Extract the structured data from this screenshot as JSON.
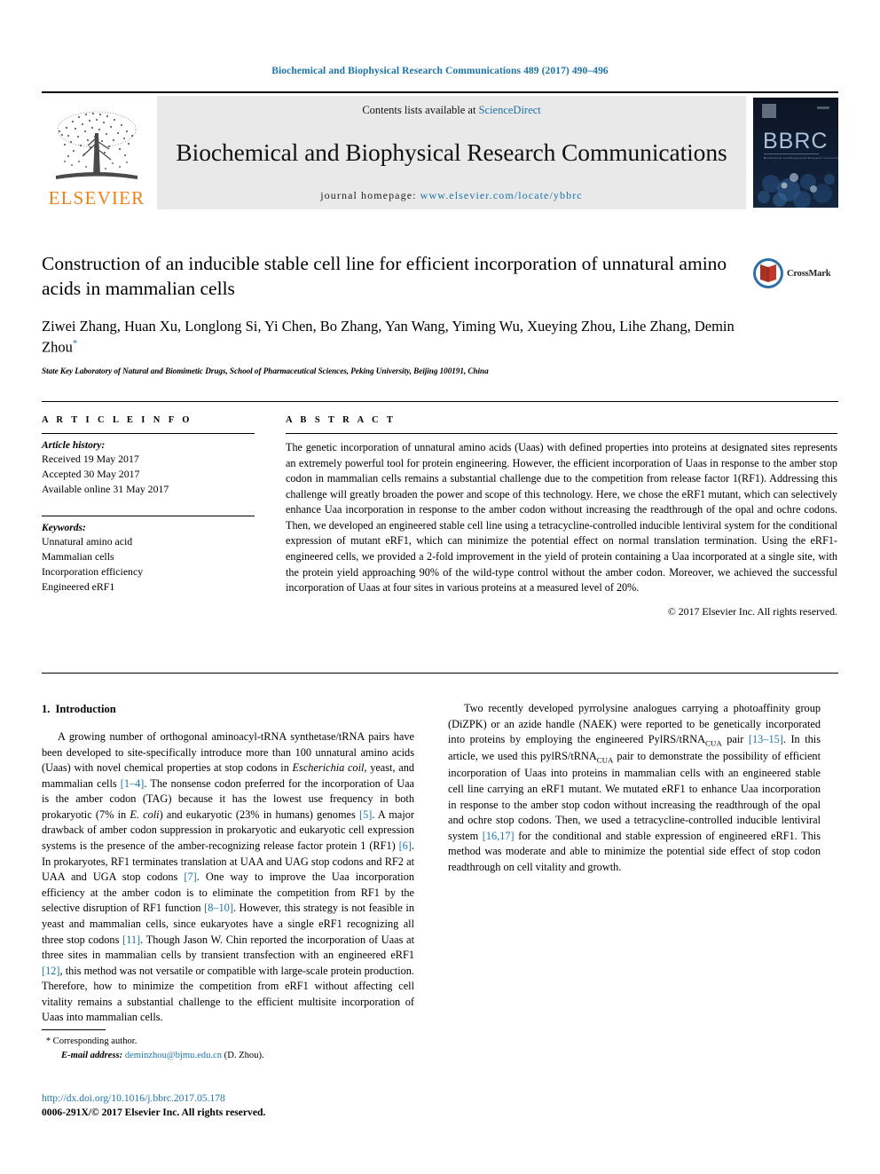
{
  "running_head": "Biochemical and Biophysical Research Communications 489 (2017) 490–496",
  "masthead": {
    "publisher_name": "ELSEVIER",
    "contents_prefix": "Contents lists available at ",
    "sciencedirect": "ScienceDirect",
    "journal_title": "Biochemical and Biophysical Research Communications",
    "homepage_label": "journal homepage: ",
    "homepage_url": "www.elsevier.com/locate/ybbrc",
    "cover_title": "BBRC",
    "cover_subtitle": "Biochemical and Biophysical Research Communications"
  },
  "crossmark": {
    "label": "CrossMark"
  },
  "article": {
    "title": "Construction of an inducible stable cell line for efficient incorporation of unnatural amino acids in mammalian cells",
    "authors": "Ziwei Zhang, Huan Xu, Longlong Si, Yi Chen, Bo Zhang, Yan Wang, Yiming Wu, Xueying Zhou, Lihe Zhang, Demin Zhou",
    "corresponding_marker": "*",
    "affiliation": "State Key Laboratory of Natural and Biomimetic Drugs, School of Pharmaceutical Sciences, Peking University, Beijing 100191, China"
  },
  "article_info": {
    "heading": "A R T I C L E   I N F O",
    "history_label": "Article history:",
    "history": [
      "Received 19 May 2017",
      "Accepted 30 May 2017",
      "Available online 31 May 2017"
    ],
    "keywords_label": "Keywords:",
    "keywords": [
      "Unnatural amino acid",
      "Mammalian cells",
      "Incorporation efficiency",
      "Engineered eRF1"
    ]
  },
  "abstract": {
    "heading": "A B S T R A C T",
    "text": "The genetic incorporation of unnatural amino acids (Uaas) with defined properties into proteins at designated sites represents an extremely powerful tool for protein engineering. However, the efficient incorporation of Uaas in response to the amber stop codon in mammalian cells remains a substantial challenge due to the competition from release factor 1(RF1). Addressing this challenge will greatly broaden the power and scope of this technology. Here, we chose the eRF1 mutant, which can selectively enhance Uaa incorporation in response to the amber codon without increasing the readthrough of the opal and ochre codons. Then, we developed an engineered stable cell line using a tetracycline-controlled inducible lentiviral system for the conditional expression of mutant eRF1, which can minimize the potential effect on normal translation termination. Using the eRF1-engineered cells, we provided a 2-fold improvement in the yield of protein containing a Uaa incorporated at a single site, with the protein yield approaching 90% of the wild-type control without the amber codon. Moreover, we achieved the successful incorporation of Uaas at four sites in various proteins at a measured level of 20%.",
    "copyright": "© 2017 Elsevier Inc. All rights reserved."
  },
  "introduction": {
    "number": "1.",
    "heading": "Introduction",
    "left_paragraph_1_parts": {
      "p1a": "A growing number of orthogonal aminoacyl-tRNA synthetase/tRNA pairs have been developed to site-specifically introduce more than 100 unnatural amino acids (Uaas) with novel chemical properties at stop codons in ",
      "p1_italic_1": "Escherichia coil",
      "p1b": ", yeast, and mammalian cells ",
      "ref1": "[1–4]",
      "p1c": ". The nonsense codon preferred for the incorporation of Uaa is the amber codon (TAG) because it has the lowest use frequency in both prokaryotic (7% in ",
      "p1_italic_2": "E. coli",
      "p1d": ") and eukaryotic (23% in humans) genomes ",
      "ref2": "[5]",
      "p1e": ". A major drawback of amber codon suppression in prokaryotic and eukaryotic cell expression systems is the presence of the amber-recognizing release factor protein 1 (RF1) ",
      "ref3": "[6]",
      "p1f": ". In prokaryotes, RF1 terminates translation at UAA and UAG stop codons and RF2 at UAA and UGA stop codons ",
      "ref4": "[7]",
      "p1g": ". One way to improve the Uaa incorporation efficiency at the amber codon is to eliminate the competition from RF1 by the selective disruption of RF1 function ",
      "ref5": "[8–10]",
      "p1h": ". However, this strategy is not feasible in yeast and mammalian cells, since eukaryotes have a single eRF1 recognizing all three stop codons ",
      "ref6": "[11]",
      "p1i": ". Though Jason W. Chin reported the incorporation of Uaas at three sites in mammalian cells by transient transfection with an engineered eRF1 ",
      "ref7": "[12]",
      "p1j": ", this method was not versatile or compatible with large-scale protein production. Therefore, how to minimize the competition from eRF1 without affecting cell vitality remains a substantial challenge to the efficient multisite incorporation of Uaas into mammalian cells."
    },
    "right_paragraph_2_parts": {
      "p2a": "Two recently developed pyrrolysine analogues carrying a photoaffinity group (DiZPK) or an azide handle (NAEK) were reported to be genetically incorporated into proteins by employing the engineered PylRS/tRNA",
      "sub1": "CUA",
      "p2b": " pair ",
      "ref8": "[13–15]",
      "p2c": ". In this article, we used this pylRS/tRNA",
      "sub2": "CUA",
      "p2d": " pair to demonstrate the possibility of efficient incorporation of Uaas into proteins in mammalian cells with an engineered stable cell line carrying an eRF1 mutant. We mutated eRF1 to enhance Uaa incorporation in response to the amber stop codon without increasing the readthrough of the opal and ochre stop codons. Then, we used a tetracycline-controlled inducible lentiviral system ",
      "ref9": "[16,17]",
      "p2e": " for the conditional and stable expression of engineered eRF1. This method was moderate and able to minimize the potential side effect of stop codon readthrough on cell vitality and growth."
    }
  },
  "footnote": {
    "corresponding_star": "*",
    "corresponding_text": "Corresponding author.",
    "email_label": "E-mail address:",
    "email": "deminzhou@bjmu.edu.cn",
    "email_suffix": "(D. Zhou)."
  },
  "footer": {
    "doi": "http://dx.doi.org/10.1016/j.bbrc.2017.05.178",
    "issn_line": "0006-291X/© 2017 Elsevier Inc. All rights reserved."
  },
  "colors": {
    "link_blue": "#1c74a8",
    "elsevier_orange": "#ec8118",
    "masthead_gray": "#e9e9e9"
  }
}
